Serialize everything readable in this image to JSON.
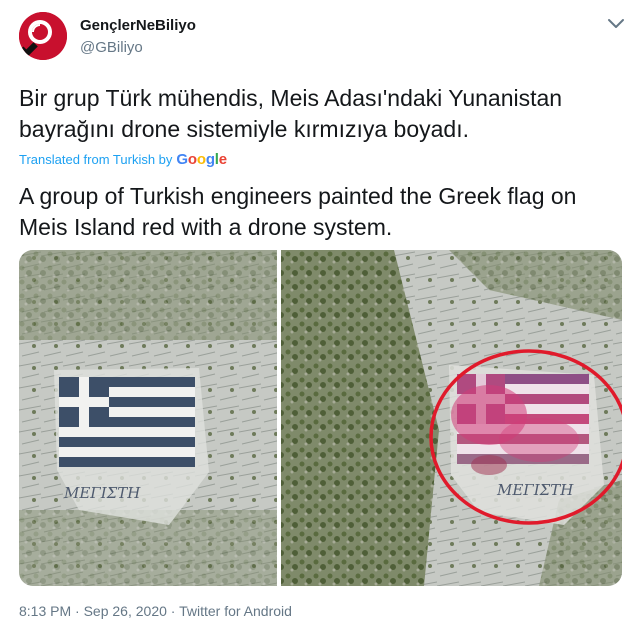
{
  "tweet": {
    "display_name": "GençlerNeBiliyo",
    "handle": "@GBiliyo",
    "text": "Bir grup Türk mühendis, Meis Adası'ndaki Yunanistan bayrağını drone sistemiyle kırmızıya boyadı.",
    "translated_label": "Translated from Turkish by",
    "google_letters": [
      "G",
      "o",
      "o",
      "g",
      "l",
      "e"
    ],
    "translated_text": "A group of Turkish engineers painted the Greek flag on Meis Island red with a drone system.",
    "time": "8:13 PM",
    "date": "Sep 26, 2020",
    "source": "Twitter for Android",
    "separator": "·"
  },
  "media": {
    "left_inscription": "ΜΕΓΙΣΤΗ",
    "right_inscription": "ΜΕΓΙΣΤΗ"
  },
  "colors": {
    "avatar_bg": "#c8102e",
    "link_blue": "#1da1f2",
    "muted_gray": "#657786",
    "greek_blue": "#0d5eaf",
    "paint_pink": "#d23c78",
    "circle_red": "#e01a2b",
    "google": [
      "#4285f4",
      "#ea4335",
      "#fbbc05",
      "#4285f4",
      "#34a853",
      "#ea4335"
    ]
  }
}
